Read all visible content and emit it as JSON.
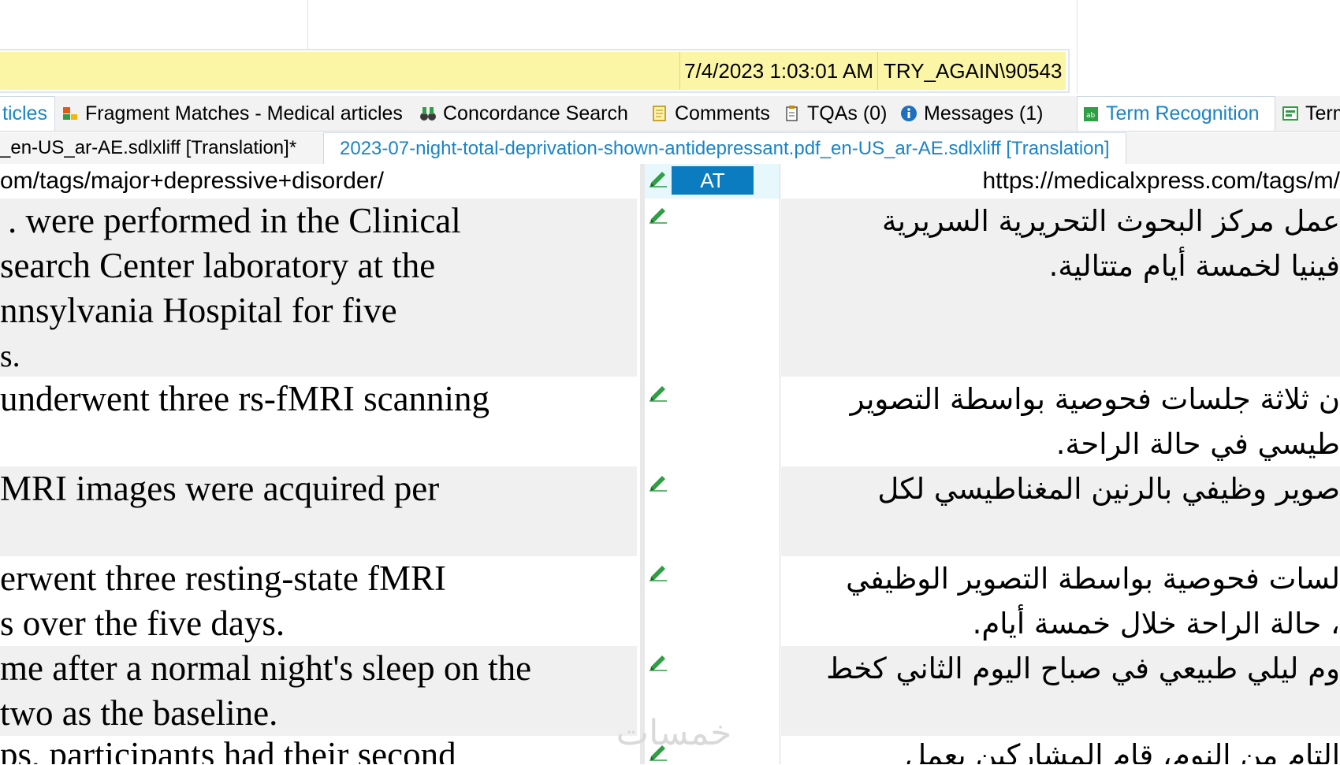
{
  "info_bar": {
    "date": "7/4/2023 1:03:01 AM",
    "user": "TRY_AGAIN\\90543"
  },
  "tabs": [
    {
      "label": "ticles",
      "active": true
    },
    {
      "label": "Fragment Matches - Medical articles",
      "icon": "fragment-icon"
    },
    {
      "label": "Concordance Search",
      "icon": "binoculars-icon"
    },
    {
      "label": "Comments",
      "icon": "comment-icon"
    },
    {
      "label": "TQAs (0)",
      "icon": "clipboard-icon"
    },
    {
      "label": "Messages (1)",
      "icon": "info-icon"
    },
    {
      "label": "Term Recognition",
      "icon": "term-recognition-icon",
      "active": true
    },
    {
      "label": "Term",
      "icon": "termbase-icon"
    }
  ],
  "doc_tabs": [
    {
      "label": "_en-US_ar-AE.sdlxliff [Translation]*"
    },
    {
      "label": "2023-07-night-total-deprivation-shown-antidepressant.pdf_en-US_ar-AE.sdlxliff [Translation]",
      "active": true
    }
  ],
  "grid": {
    "header_row": {
      "source": "om/tags/major+depressive+disorder/",
      "status": "AT",
      "target": "/https://medicalxpress.com/tags/m"
    },
    "rows": [
      {
        "source": [
          ". were performed in the Clinical",
          "search Center laboratory at the",
          "nnsylvania Hospital for five",
          "s."
        ],
        "target": [
          "عمل مركز البحوث التحريرية السريرية",
          "فينيا لخمسة أيام متتالية."
        ]
      },
      {
        "source": [
          "underwent three rs-fMRI scanning"
        ],
        "target": [
          "ن ثلاثة جلسات فحوصية بواسطة التصوير",
          "طيسي في حالة الراحة."
        ]
      },
      {
        "source": [
          "MRI images were acquired per"
        ],
        "target": [
          "صوير وظيفي بالرنين المغناطيسي لكل"
        ]
      },
      {
        "source": [
          "erwent three resting-state fMRI",
          "s over the five days."
        ],
        "target": [
          "لسات فحوصية بواسطة التصوير الوظيفي",
          "، حالة الراحة خلال خمسة أيام."
        ]
      },
      {
        "source": [
          "me after a normal night's sleep on the",
          "two as the baseline."
        ],
        "target": [
          "وم ليلي طبيعي في صباح اليوم الثاني كخط"
        ]
      },
      {
        "source": [
          "ps, participants had their second"
        ],
        "target": [
          "التام من النوم، قام المشاركين بعمل"
        ]
      }
    ]
  },
  "watermark": "خمسات",
  "colors": {
    "info_bar": "#fbf6a6",
    "accent": "#1a84c7",
    "status_badge": "#0c7cc1",
    "row_shade": "#f0f0f0"
  }
}
